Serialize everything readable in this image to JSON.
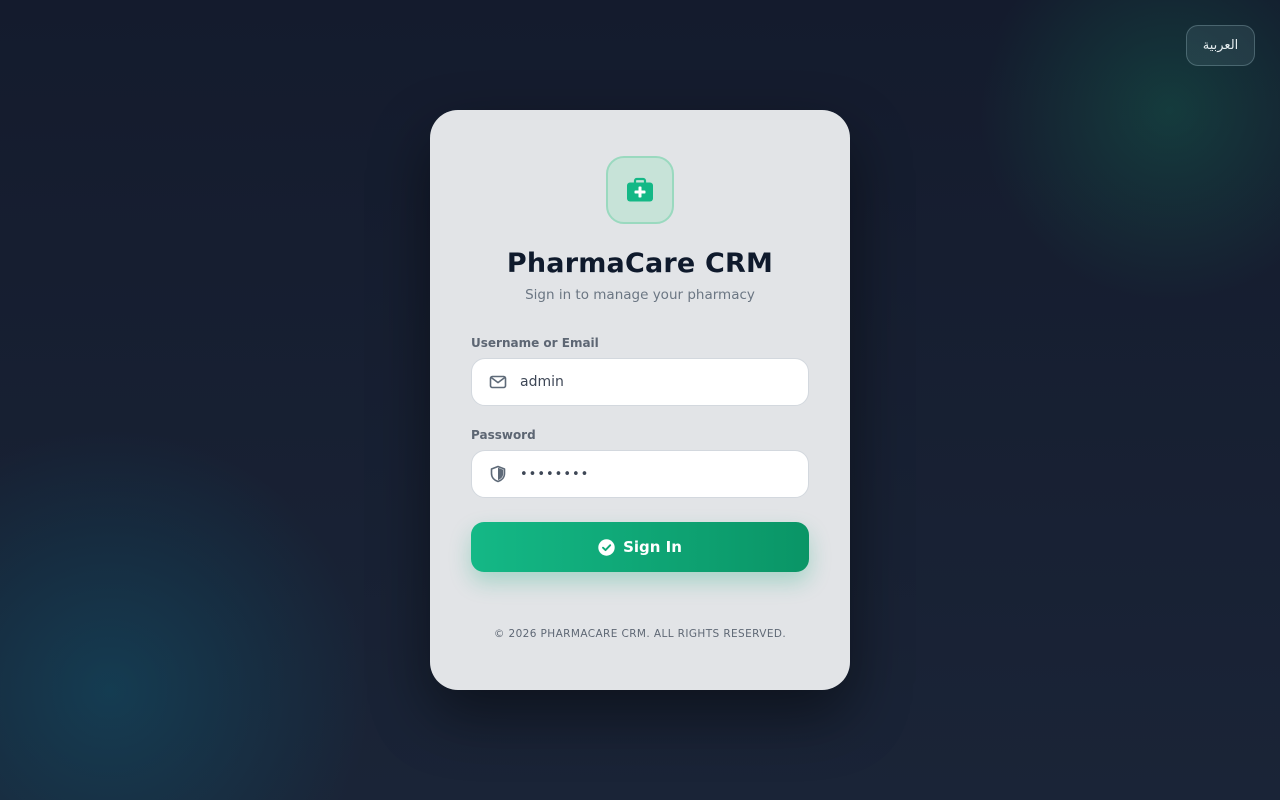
{
  "language_toggle": {
    "label": "العربية"
  },
  "card": {
    "logo_icon": "medical-kit-icon",
    "title": "PharmaCare CRM",
    "subtitle": "Sign in to manage your pharmacy"
  },
  "form": {
    "username": {
      "label": "Username or Email",
      "value": "admin",
      "icon": "mail-icon"
    },
    "password": {
      "label": "Password",
      "value": "••••••••",
      "icon": "shield-icon"
    },
    "submit": {
      "label": "Sign In",
      "icon": "check-circle-icon"
    }
  },
  "footer": {
    "text": "© 2026 PHARMACARE CRM. ALL RIGHTS RESERVED."
  },
  "colors": {
    "accent": "#10b981",
    "accent_dark": "#0a9566",
    "title": "#0f1a2c",
    "card_bg": "#e2e4e7",
    "page_bg": "#161f33"
  }
}
